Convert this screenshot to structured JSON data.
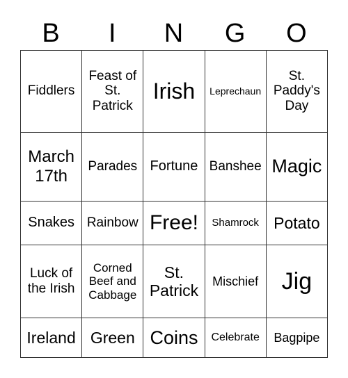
{
  "header": [
    "B",
    "I",
    "N",
    "G",
    "O"
  ],
  "cells": [
    [
      "Fiddlers",
      "Feast of St. Patrick",
      "Irish",
      "Leprechaun",
      "St. Paddy's Day"
    ],
    [
      "March 17th",
      "Parades",
      "Fortune",
      "Banshee",
      "Magic"
    ],
    [
      "Snakes",
      "Rainbow",
      "Free!",
      "Shamrock",
      "Potato"
    ],
    [
      "Luck of the Irish",
      "Corned Beef and Cabbage",
      "St. Patrick",
      "Mischief",
      "Jig"
    ],
    [
      "Ireland",
      "Green",
      "Coins",
      "Celebrate",
      "Bagpipe"
    ]
  ]
}
